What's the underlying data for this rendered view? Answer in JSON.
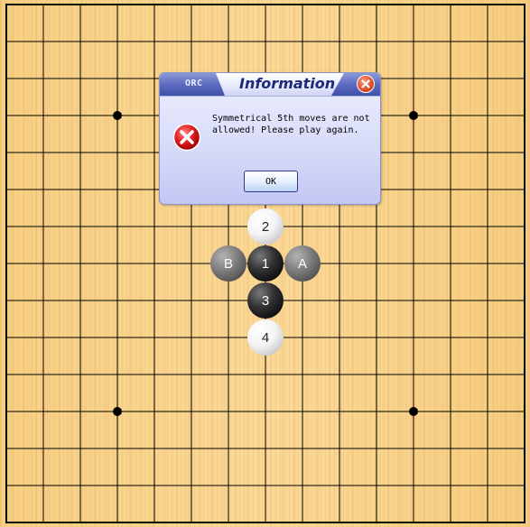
{
  "board": {
    "size": 15,
    "star_points": [
      [
        3,
        3
      ],
      [
        11,
        3
      ],
      [
        3,
        11
      ],
      [
        11,
        11
      ]
    ]
  },
  "stones": [
    {
      "label": "1",
      "color": "black",
      "col": 7,
      "row": 7
    },
    {
      "label": "2",
      "color": "white",
      "col": 7,
      "row": 6
    },
    {
      "label": "3",
      "color": "black",
      "col": 7,
      "row": 8
    },
    {
      "label": "4",
      "color": "white",
      "col": 7,
      "row": 9
    },
    {
      "label": "A",
      "color": "gray",
      "col": 8,
      "row": 7
    },
    {
      "label": "B",
      "color": "gray",
      "col": 6,
      "row": 7
    }
  ],
  "dialog": {
    "brand": "ORC",
    "title": "Information",
    "message_line1": "Symmetrical 5th moves are not",
    "message_line2": "allowed! Please play again.",
    "ok_label": "OK",
    "icon": "error-icon",
    "close_icon": "close-icon"
  }
}
